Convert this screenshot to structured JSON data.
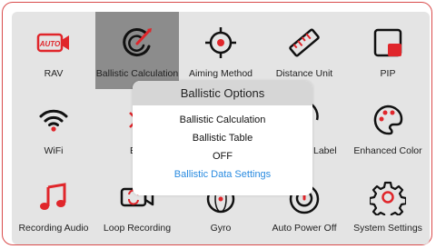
{
  "colors": {
    "accent_red": "#e0262b",
    "link_blue": "#2a8be0",
    "selected_tile": "#8c8c8c"
  },
  "grid": {
    "tiles": [
      {
        "label": "RAV",
        "icon": "auto-camera-icon",
        "selected": false
      },
      {
        "label": "Ballistic Calculation",
        "icon": "ballistic-calculation-icon",
        "selected": true
      },
      {
        "label": "Aiming Method",
        "icon": "crosshair-icon",
        "selected": false
      },
      {
        "label": "Distance Unit",
        "icon": "ruler-icon",
        "selected": false
      },
      {
        "label": "PIP",
        "icon": "picture-in-picture-icon",
        "selected": false
      },
      {
        "label": "WiFi",
        "icon": "wifi-icon",
        "selected": false
      },
      {
        "label": "Blu",
        "icon": "bluetooth-icon",
        "selected": false
      },
      {
        "label": "",
        "icon": "hidden-tile",
        "selected": false
      },
      {
        "label": "Label",
        "icon": "heat-label-icon",
        "selected": false
      },
      {
        "label": "Enhanced Color",
        "icon": "palette-icon",
        "selected": false
      },
      {
        "label": "Recording Audio",
        "icon": "music-note-icon",
        "selected": false
      },
      {
        "label": "Loop Recording",
        "icon": "loop-recording-icon",
        "selected": false
      },
      {
        "label": "Gyro",
        "icon": "gyro-icon",
        "selected": false
      },
      {
        "label": "Auto Power Off",
        "icon": "power-icon",
        "selected": false
      },
      {
        "label": "System Settings",
        "icon": "gear-icon",
        "selected": false
      }
    ]
  },
  "dialog": {
    "title": "Ballistic Options",
    "options": [
      {
        "label": "Ballistic Calculation"
      },
      {
        "label": "Ballistic Table"
      },
      {
        "label": "OFF"
      },
      {
        "label": "Ballistic Data Settings"
      }
    ]
  }
}
